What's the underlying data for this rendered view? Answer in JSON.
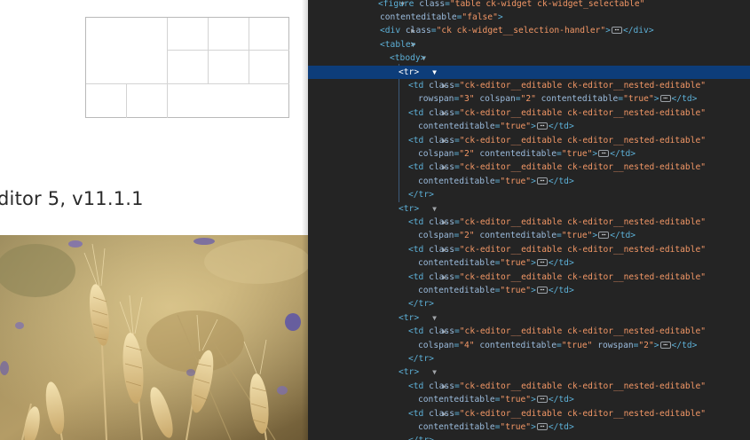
{
  "page": {
    "heading": "ditor 5, v11.1.1"
  },
  "devtools": {
    "lines": [
      {
        "indent": 0,
        "arrow": "open",
        "selected": false,
        "parts": [
          [
            "tag",
            "<figure "
          ],
          [
            "an",
            "class"
          ],
          [
            "tag",
            "="
          ],
          [
            "av",
            "\"table ck-widget ck-widget_selectable\""
          ]
        ]
      },
      {
        "indent": 1,
        "arrow": "",
        "selected": false,
        "parts": [
          [
            "an",
            "contenteditable"
          ],
          [
            "tag",
            "="
          ],
          [
            "av",
            "\"false\""
          ],
          [
            "tag",
            ">"
          ]
        ]
      },
      {
        "indent": 1,
        "arrow": "closed",
        "selected": false,
        "parts": [
          [
            "tag",
            "<div "
          ],
          [
            "an",
            "class"
          ],
          [
            "tag",
            "="
          ],
          [
            "av",
            "\"ck ck-widget__selection-handler\""
          ],
          [
            "tag",
            ">"
          ],
          [
            "ell",
            ""
          ],
          [
            "tag",
            "</div>"
          ]
        ]
      },
      {
        "indent": 1,
        "arrow": "open",
        "selected": false,
        "parts": [
          [
            "tag",
            "<table>"
          ]
        ]
      },
      {
        "indent": 2,
        "arrow": "open",
        "selected": false,
        "parts": [
          [
            "tag",
            "<tbody>"
          ]
        ]
      },
      {
        "indent": 3,
        "arrow": "open",
        "selected": true,
        "parts": [
          [
            "tag",
            "<tr>"
          ]
        ]
      },
      {
        "indent": 4,
        "arrow": "closed",
        "selected": false,
        "parts": [
          [
            "tag",
            "<td "
          ],
          [
            "an",
            "class"
          ],
          [
            "tag",
            "="
          ],
          [
            "av",
            "\"ck-editor__editable ck-editor__nested-editable\""
          ]
        ]
      },
      {
        "indent": 5,
        "arrow": "",
        "selected": false,
        "parts": [
          [
            "an",
            "rowspan"
          ],
          [
            "tag",
            "="
          ],
          [
            "av",
            "\"3\" "
          ],
          [
            "an",
            "colspan"
          ],
          [
            "tag",
            "="
          ],
          [
            "av",
            "\"2\" "
          ],
          [
            "an",
            "contenteditable"
          ],
          [
            "tag",
            "="
          ],
          [
            "av",
            "\"true\""
          ],
          [
            "tag",
            ">"
          ],
          [
            "ell",
            ""
          ],
          [
            "tag",
            "</td>"
          ]
        ]
      },
      {
        "indent": 4,
        "arrow": "closed",
        "selected": false,
        "parts": [
          [
            "tag",
            "<td "
          ],
          [
            "an",
            "class"
          ],
          [
            "tag",
            "="
          ],
          [
            "av",
            "\"ck-editor__editable ck-editor__nested-editable\""
          ]
        ]
      },
      {
        "indent": 5,
        "arrow": "",
        "selected": false,
        "parts": [
          [
            "an",
            "contenteditable"
          ],
          [
            "tag",
            "="
          ],
          [
            "av",
            "\"true\""
          ],
          [
            "tag",
            ">"
          ],
          [
            "ell",
            ""
          ],
          [
            "tag",
            "</td>"
          ]
        ]
      },
      {
        "indent": 4,
        "arrow": "closed",
        "selected": false,
        "parts": [
          [
            "tag",
            "<td "
          ],
          [
            "an",
            "class"
          ],
          [
            "tag",
            "="
          ],
          [
            "av",
            "\"ck-editor__editable ck-editor__nested-editable\""
          ]
        ]
      },
      {
        "indent": 5,
        "arrow": "",
        "selected": false,
        "parts": [
          [
            "an",
            "colspan"
          ],
          [
            "tag",
            "="
          ],
          [
            "av",
            "\"2\" "
          ],
          [
            "an",
            "contenteditable"
          ],
          [
            "tag",
            "="
          ],
          [
            "av",
            "\"true\""
          ],
          [
            "tag",
            ">"
          ],
          [
            "ell",
            ""
          ],
          [
            "tag",
            "</td>"
          ]
        ]
      },
      {
        "indent": 4,
        "arrow": "closed",
        "selected": false,
        "parts": [
          [
            "tag",
            "<td "
          ],
          [
            "an",
            "class"
          ],
          [
            "tag",
            "="
          ],
          [
            "av",
            "\"ck-editor__editable ck-editor__nested-editable\""
          ]
        ]
      },
      {
        "indent": 5,
        "arrow": "",
        "selected": false,
        "parts": [
          [
            "an",
            "contenteditable"
          ],
          [
            "tag",
            "="
          ],
          [
            "av",
            "\"true\""
          ],
          [
            "tag",
            ">"
          ],
          [
            "ell",
            ""
          ],
          [
            "tag",
            "</td>"
          ]
        ]
      },
      {
        "indent": 4,
        "arrow": "",
        "selected": false,
        "parts": [
          [
            "tag",
            "</tr>"
          ]
        ]
      },
      {
        "indent": 3,
        "arrow": "open",
        "selected": false,
        "parts": [
          [
            "tag",
            "<tr>"
          ]
        ]
      },
      {
        "indent": 4,
        "arrow": "closed",
        "selected": false,
        "parts": [
          [
            "tag",
            "<td "
          ],
          [
            "an",
            "class"
          ],
          [
            "tag",
            "="
          ],
          [
            "av",
            "\"ck-editor__editable ck-editor__nested-editable\""
          ]
        ]
      },
      {
        "indent": 5,
        "arrow": "",
        "selected": false,
        "parts": [
          [
            "an",
            "colspan"
          ],
          [
            "tag",
            "="
          ],
          [
            "av",
            "\"2\" "
          ],
          [
            "an",
            "contenteditable"
          ],
          [
            "tag",
            "="
          ],
          [
            "av",
            "\"true\""
          ],
          [
            "tag",
            ">"
          ],
          [
            "ell",
            ""
          ],
          [
            "tag",
            "</td>"
          ]
        ]
      },
      {
        "indent": 4,
        "arrow": "closed",
        "selected": false,
        "parts": [
          [
            "tag",
            "<td "
          ],
          [
            "an",
            "class"
          ],
          [
            "tag",
            "="
          ],
          [
            "av",
            "\"ck-editor__editable ck-editor__nested-editable\""
          ]
        ]
      },
      {
        "indent": 5,
        "arrow": "",
        "selected": false,
        "parts": [
          [
            "an",
            "contenteditable"
          ],
          [
            "tag",
            "="
          ],
          [
            "av",
            "\"true\""
          ],
          [
            "tag",
            ">"
          ],
          [
            "ell",
            ""
          ],
          [
            "tag",
            "</td>"
          ]
        ]
      },
      {
        "indent": 4,
        "arrow": "closed",
        "selected": false,
        "parts": [
          [
            "tag",
            "<td "
          ],
          [
            "an",
            "class"
          ],
          [
            "tag",
            "="
          ],
          [
            "av",
            "\"ck-editor__editable ck-editor__nested-editable\""
          ]
        ]
      },
      {
        "indent": 5,
        "arrow": "",
        "selected": false,
        "parts": [
          [
            "an",
            "contenteditable"
          ],
          [
            "tag",
            "="
          ],
          [
            "av",
            "\"true\""
          ],
          [
            "tag",
            ">"
          ],
          [
            "ell",
            ""
          ],
          [
            "tag",
            "</td>"
          ]
        ]
      },
      {
        "indent": 4,
        "arrow": "",
        "selected": false,
        "parts": [
          [
            "tag",
            "</tr>"
          ]
        ]
      },
      {
        "indent": 3,
        "arrow": "open",
        "selected": false,
        "parts": [
          [
            "tag",
            "<tr>"
          ]
        ]
      },
      {
        "indent": 4,
        "arrow": "closed",
        "selected": false,
        "parts": [
          [
            "tag",
            "<td "
          ],
          [
            "an",
            "class"
          ],
          [
            "tag",
            "="
          ],
          [
            "av",
            "\"ck-editor__editable ck-editor__nested-editable\""
          ]
        ]
      },
      {
        "indent": 5,
        "arrow": "",
        "selected": false,
        "parts": [
          [
            "an",
            "colspan"
          ],
          [
            "tag",
            "="
          ],
          [
            "av",
            "\"4\" "
          ],
          [
            "an",
            "contenteditable"
          ],
          [
            "tag",
            "="
          ],
          [
            "av",
            "\"true\" "
          ],
          [
            "an",
            "rowspan"
          ],
          [
            "tag",
            "="
          ],
          [
            "av",
            "\"2\""
          ],
          [
            "tag",
            ">"
          ],
          [
            "ell",
            ""
          ],
          [
            "tag",
            "</td>"
          ]
        ]
      },
      {
        "indent": 4,
        "arrow": "",
        "selected": false,
        "parts": [
          [
            "tag",
            "</tr>"
          ]
        ]
      },
      {
        "indent": 3,
        "arrow": "open",
        "selected": false,
        "parts": [
          [
            "tag",
            "<tr>"
          ]
        ]
      },
      {
        "indent": 4,
        "arrow": "closed",
        "selected": false,
        "parts": [
          [
            "tag",
            "<td "
          ],
          [
            "an",
            "class"
          ],
          [
            "tag",
            "="
          ],
          [
            "av",
            "\"ck-editor__editable ck-editor__nested-editable\""
          ]
        ]
      },
      {
        "indent": 5,
        "arrow": "",
        "selected": false,
        "parts": [
          [
            "an",
            "contenteditable"
          ],
          [
            "tag",
            "="
          ],
          [
            "av",
            "\"true\""
          ],
          [
            "tag",
            ">"
          ],
          [
            "ell",
            ""
          ],
          [
            "tag",
            "</td>"
          ]
        ]
      },
      {
        "indent": 4,
        "arrow": "closed",
        "selected": false,
        "parts": [
          [
            "tag",
            "<td "
          ],
          [
            "an",
            "class"
          ],
          [
            "tag",
            "="
          ],
          [
            "av",
            "\"ck-editor__editable ck-editor__nested-editable\""
          ]
        ]
      },
      {
        "indent": 5,
        "arrow": "",
        "selected": false,
        "parts": [
          [
            "an",
            "contenteditable"
          ],
          [
            "tag",
            "="
          ],
          [
            "av",
            "\"true\""
          ],
          [
            "tag",
            ">"
          ],
          [
            "ell",
            ""
          ],
          [
            "tag",
            "</td>"
          ]
        ]
      },
      {
        "indent": 4,
        "arrow": "",
        "selected": false,
        "parts": [
          [
            "tag",
            "</tr>"
          ]
        ]
      }
    ]
  },
  "colors": {
    "devtools_bg": "#242424",
    "selection": "#0d3d7a",
    "tag": "#5db0d7",
    "attr_name": "#9bbbdc",
    "attr_value": "#f29766"
  }
}
